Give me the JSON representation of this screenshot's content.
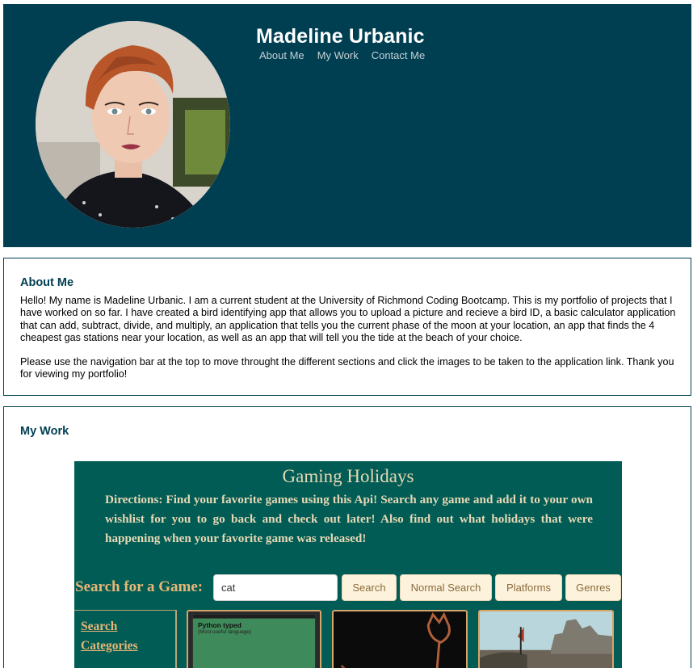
{
  "header": {
    "title": "Madeline Urbanic",
    "nav": [
      "About Me",
      "My Work",
      "Contact Me"
    ]
  },
  "about": {
    "heading": "About Me",
    "paragraphs": [
      "Hello! My name is Madeline Urbanic. I am a current student at the University of Richmond Coding Bootcamp. This is my portfolio of projects that I have worked on so far. I have created a bird identifying app that allows you to upload a picture and recieve a bird ID, a basic calculator application that can add, subtract, divide, and multiply, an application that tells you the current phase of the moon at your location, an app that finds the 4 cheapest gas stations near your location, as well as an app that will tell you the tide at the beach of your choice.",
      "Please use the navigation bar at the top to move throught the different sections and click the images to be taken to the application link. Thank you for viewing my portfolio!"
    ]
  },
  "work": {
    "heading": "My Work",
    "project": {
      "title": "Gaming Holidays",
      "directions": "Directions: Find your favorite games using this Api! Search any game and add it to your own wishlist for you to go back and check out later! Also find out what holidays that were happening when your favorite game was released!",
      "search_label": "Search for a Game:",
      "search_value": "cat",
      "buttons": [
        "Search",
        "Normal Search",
        "Platforms",
        "Genres"
      ],
      "sidebar_links": [
        "Search",
        "Categories"
      ],
      "card1": {
        "title": "Python typed",
        "subtitle": "(Most useful language)"
      }
    }
  },
  "colors": {
    "header_bg": "#003f52",
    "project_bg": "#005c55",
    "accent": "#e8b676"
  }
}
